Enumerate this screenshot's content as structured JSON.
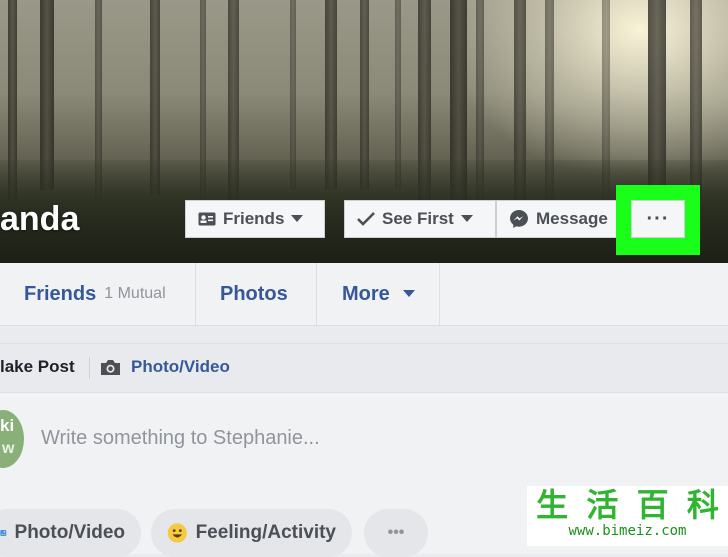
{
  "profile": {
    "name_fragment": "anda"
  },
  "cover_buttons": {
    "friends_label": "Friends",
    "see_first_label": "See First",
    "message_label": "Message",
    "more_options": "···"
  },
  "nav": {
    "friends_label": "Friends",
    "mutual_label": "1 Mutual",
    "photos_label": "Photos",
    "more_label": "More"
  },
  "composer": {
    "make_post_label": "lake Post",
    "photo_video_label": "Photo/Video",
    "avatar_text_1": "ki",
    "avatar_text_2": "w",
    "placeholder": "Write something to Stephanie..."
  },
  "actions": {
    "photo_video_label": "Photo/Video",
    "feeling_label": "Feeling/Activity",
    "more_label": "•••"
  },
  "watermark": {
    "chars": [
      "生",
      "活",
      "百",
      "科"
    ],
    "url": "www.bimeiz.com"
  },
  "colors": {
    "link_blue": "#365899",
    "highlight_green": "#1aff1a",
    "button_text": "#4b4f56"
  }
}
